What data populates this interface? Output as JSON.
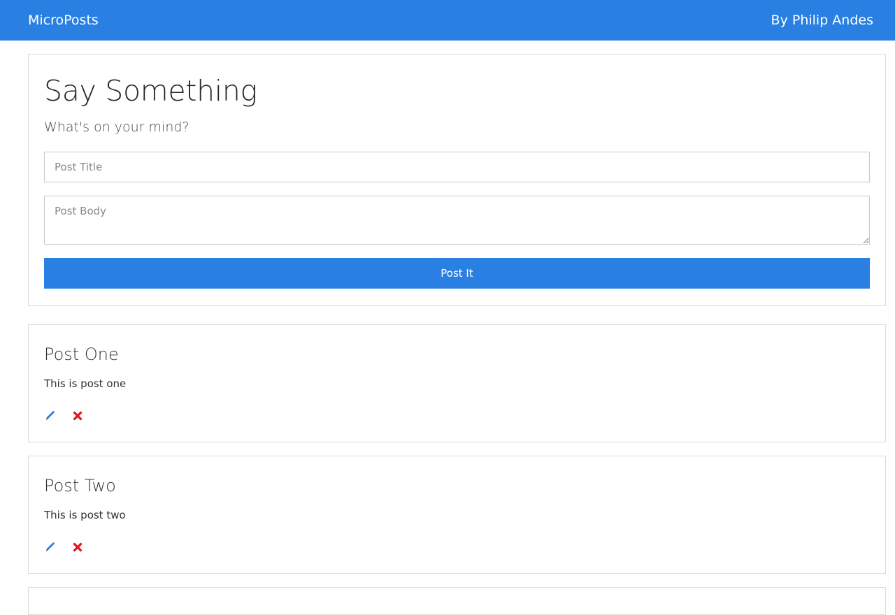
{
  "navbar": {
    "brand": "MicroPosts",
    "author": "By Philip Andes"
  },
  "form": {
    "heading": "Say Something",
    "lead": "What's on your mind?",
    "title_placeholder": "Post Title",
    "body_placeholder": "Post Body",
    "submit_label": "Post It"
  },
  "posts": [
    {
      "title": "Post One",
      "body": "This is post one",
      "edit_icon": "pencil-icon",
      "delete_icon": "remove-icon"
    },
    {
      "title": "Post Two",
      "body": "This is post two",
      "edit_icon": "pencil-icon",
      "delete_icon": "remove-icon"
    }
  ],
  "colors": {
    "primary": "#2a80e2",
    "danger": "#e0161d",
    "border": "#dcdcdc"
  }
}
